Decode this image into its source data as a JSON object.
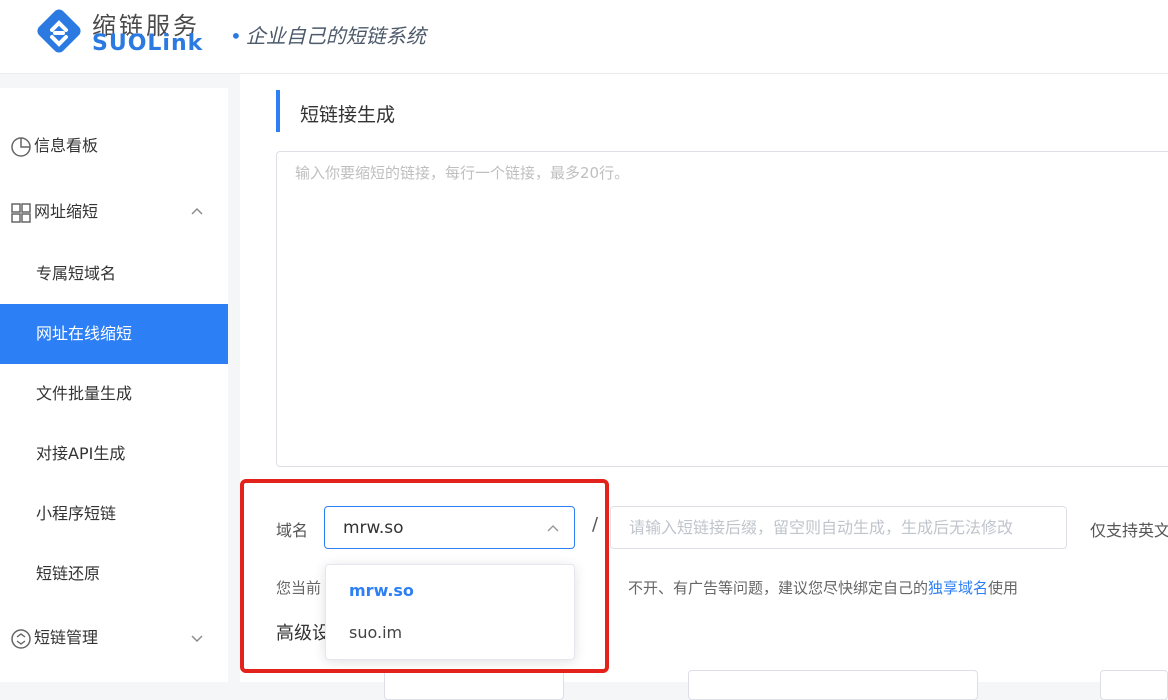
{
  "header": {
    "brand_cn": "缩链服务",
    "brand_en": "SUOLink",
    "slogan": "企业自己的短链系统"
  },
  "sidebar": {
    "items": [
      {
        "label": "信息看板",
        "icon": "dashboard-pie-icon"
      },
      {
        "label": "网址缩短",
        "icon": "grid-apps-icon",
        "expanded": true
      },
      {
        "label": "专属短域名",
        "sub": true
      },
      {
        "label": "网址在线缩短",
        "sub": true,
        "active": true
      },
      {
        "label": "文件批量生成",
        "sub": true
      },
      {
        "label": "对接API生成",
        "sub": true
      },
      {
        "label": "小程序短链",
        "sub": true
      },
      {
        "label": "短链还原",
        "sub": true
      },
      {
        "label": "短链管理",
        "icon": "link-manage-icon",
        "expanded": false
      }
    ]
  },
  "main": {
    "title": "短链接生成",
    "links_placeholder": "输入你要缩短的链接，每行一个链接，最多20行。",
    "domain_label": "域名",
    "domain_value": "mrw.so",
    "slash": "/",
    "suffix_placeholder": "请输入短链接后缀，留空则自动生成，生成后无法修改",
    "suffix_hint": "仅支持英文",
    "notice_start": "您当前",
    "notice_mid": "不开、有广告等问题，建议您尽快绑定自己的",
    "notice_link": "独享域名",
    "notice_end": "使用",
    "advanced_title": "高级设"
  },
  "dropdown": {
    "options": [
      "mrw.so",
      "suo.im"
    ],
    "selected": "mrw.so"
  },
  "colors": {
    "accent": "#2d7ff5",
    "highlight": "#e3221b"
  }
}
